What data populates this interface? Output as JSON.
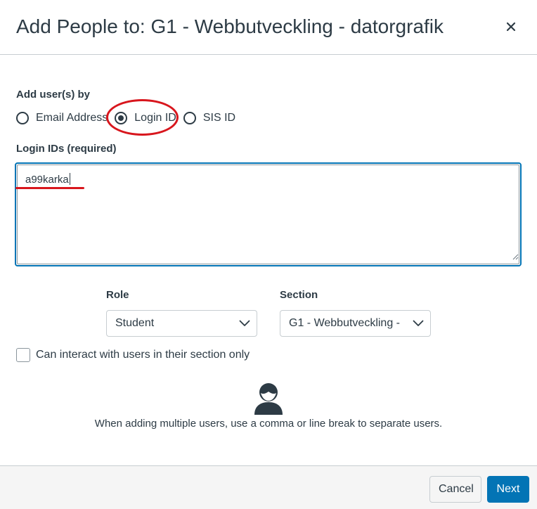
{
  "dialog": {
    "title": "Add People to: G1 - Webbutveckling - datorgrafik",
    "close_icon": "close-icon"
  },
  "add_by": {
    "label": "Add user(s) by",
    "options": [
      {
        "label": "Email Address",
        "checked": false
      },
      {
        "label": "Login ID",
        "checked": true
      },
      {
        "label": "SIS ID",
        "checked": false
      }
    ]
  },
  "login_ids": {
    "label": "Login IDs (required)",
    "value": "a99karka"
  },
  "role": {
    "label": "Role",
    "selected": "Student"
  },
  "section": {
    "label": "Section",
    "selected": "G1 - Webbutveckling -"
  },
  "limit_section": {
    "label": "Can interact with users in their section only",
    "checked": false
  },
  "help_text": "When adding multiple users, use a comma or line break to separate users.",
  "footer": {
    "cancel_label": "Cancel",
    "next_label": "Next"
  },
  "colors": {
    "primary": "#0374b5",
    "text": "#2d3b45",
    "annotation": "#d8161d",
    "border": "#c7cdd1"
  }
}
